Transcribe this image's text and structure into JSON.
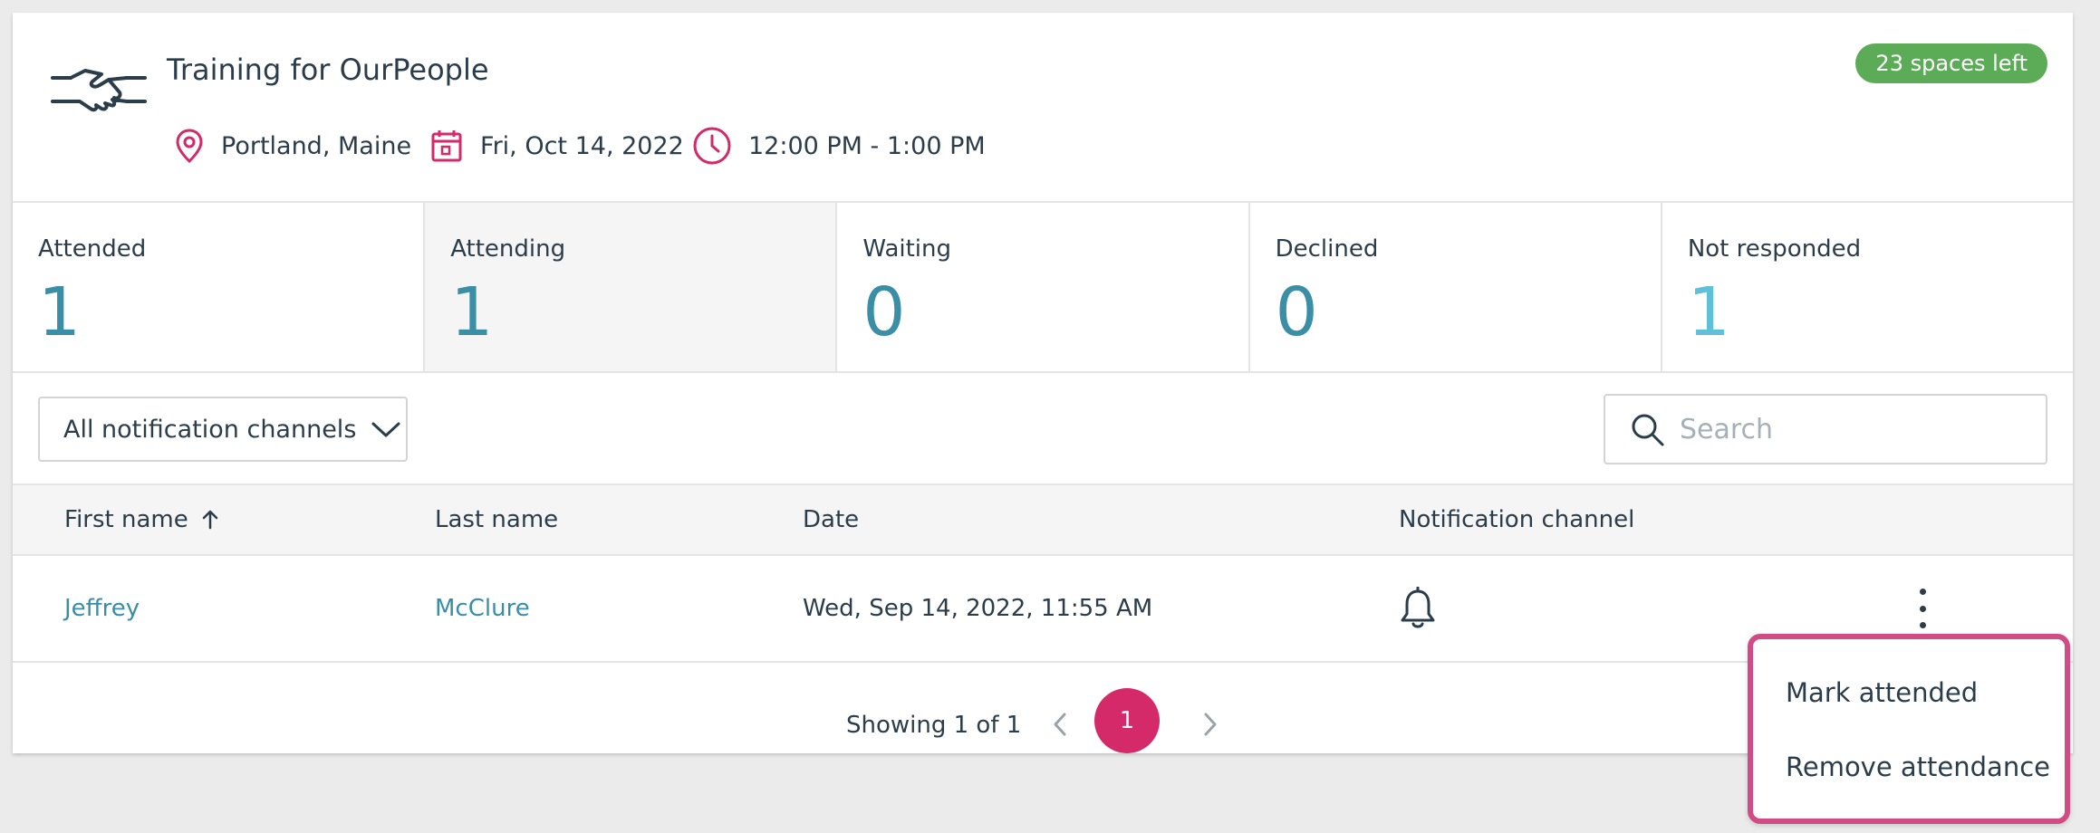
{
  "event": {
    "title": "Training for OurPeople",
    "spaces_badge": "23 spaces left",
    "location": "Portland, Maine",
    "date": "Fri, Oct 14, 2022",
    "time": "12:00 PM - 1:00 PM",
    "icon": "handshake-icon"
  },
  "stats": [
    {
      "label": "Attended",
      "value": "1"
    },
    {
      "label": "Attending",
      "value": "1"
    },
    {
      "label": "Waiting",
      "value": "0"
    },
    {
      "label": "Declined",
      "value": "0"
    },
    {
      "label": "Not responded",
      "value": "1"
    }
  ],
  "filter": {
    "label": "All notification channels"
  },
  "search": {
    "placeholder": "Search"
  },
  "table": {
    "headers": [
      "First name",
      "Last name",
      "Date",
      "Notification channel"
    ],
    "sort": "ascending",
    "rows": [
      {
        "first_name": "Jeffrey",
        "last_name": "McClure",
        "date": "Wed, Sep 14, 2022, 11:55 AM",
        "channel_icon": "bell-icon"
      }
    ]
  },
  "pagination": {
    "showing": "Showing 1 of 1",
    "current_page": "1"
  },
  "menu": {
    "items": [
      "Mark attended",
      "Remove attendance"
    ]
  },
  "colors": {
    "accent": "#d42a6a",
    "badge": "#5cab57",
    "stat_value": "#3a8ea6",
    "stat_value_light": "#5fc0d8",
    "link": "#3a8ea6",
    "menu_border": "#d14c84"
  }
}
